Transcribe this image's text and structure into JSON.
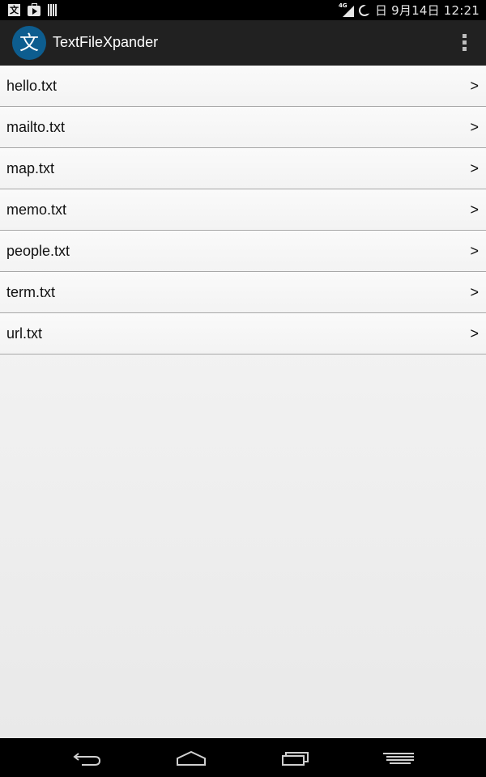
{
  "status_bar": {
    "datetime": "日 9月14日 12:21",
    "network_type": "4G",
    "left_icons": [
      "wen-character-icon",
      "play-store-bag-icon",
      "barcode-icon"
    ]
  },
  "action_bar": {
    "logo_char": "文",
    "title": "TextFileXpander"
  },
  "files": [
    {
      "name": "hello.txt",
      "chevron": ">"
    },
    {
      "name": "mailto.txt",
      "chevron": ">"
    },
    {
      "name": "map.txt",
      "chevron": ">"
    },
    {
      "name": "memo.txt",
      "chevron": ">"
    },
    {
      "name": "people.txt",
      "chevron": ">"
    },
    {
      "name": "term.txt",
      "chevron": ">"
    },
    {
      "name": "url.txt",
      "chevron": ">"
    }
  ],
  "colors": {
    "action_bar_bg": "#212121",
    "logo_bg": "#0d5d8f",
    "divider": "#a8a8a8"
  }
}
